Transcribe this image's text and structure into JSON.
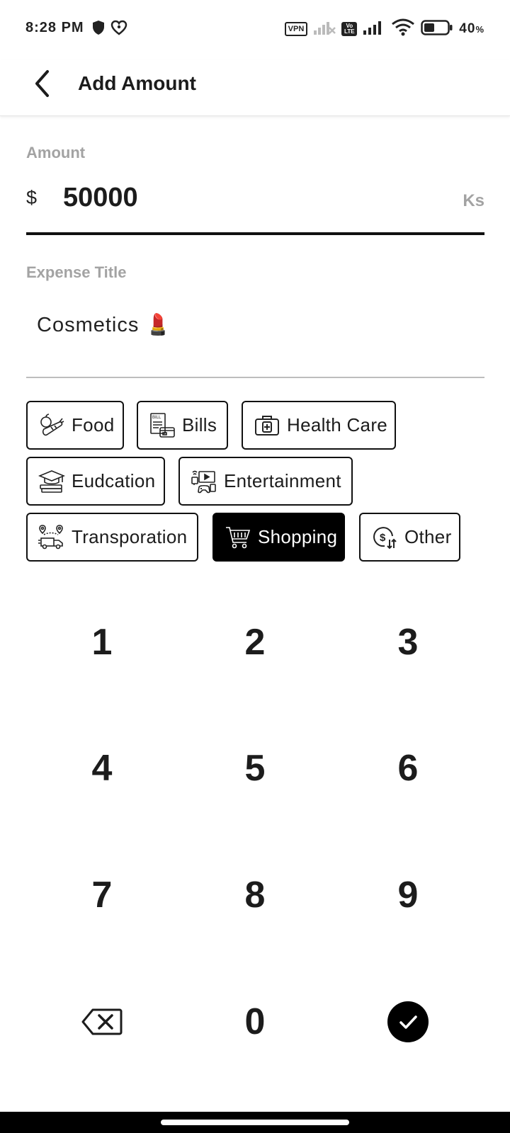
{
  "status": {
    "time": "8:28 PM",
    "vpn": "VPN",
    "volte": "Vo LTE",
    "battery": "40",
    "battery_unit": "%"
  },
  "header": {
    "title": "Add Amount",
    "back_icon": "back-arrow-icon"
  },
  "amount": {
    "label": "Amount",
    "currency_symbol": "$",
    "value": "50000",
    "unit": "Ks"
  },
  "expense_title": {
    "label": "Expense Title",
    "value": "Cosmetics 💄"
  },
  "categories": [
    {
      "label": "Food",
      "icon": "food-icon",
      "selected": false
    },
    {
      "label": "Bills",
      "icon": "bill-icon",
      "selected": false
    },
    {
      "label": "Health Care",
      "icon": "medical-kit-icon",
      "selected": false
    },
    {
      "label": "Eudcation",
      "icon": "graduation-cap-icon",
      "selected": false
    },
    {
      "label": "Entertainment",
      "icon": "entertainment-icon",
      "selected": false
    },
    {
      "label": "Transporation",
      "icon": "delivery-truck-icon",
      "selected": false
    },
    {
      "label": "Shopping",
      "icon": "shopping-cart-icon",
      "selected": true
    },
    {
      "label": "Other",
      "icon": "money-exchange-icon",
      "selected": false
    }
  ],
  "keypad": {
    "keys": [
      "1",
      "2",
      "3",
      "4",
      "5",
      "6",
      "7",
      "8",
      "9",
      "0"
    ],
    "backspace_icon": "backspace-icon",
    "confirm_icon": "checkmark-icon"
  },
  "colors": {
    "accent": "#000000",
    "label_gray": "#a3a3a3",
    "text": "#1c1c1c"
  }
}
